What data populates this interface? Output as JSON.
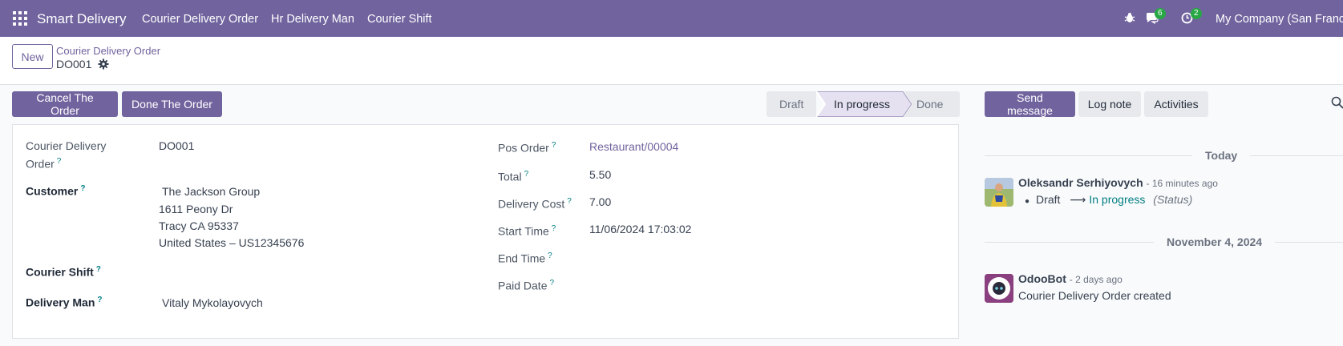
{
  "navbar": {
    "brand": "Smart Delivery",
    "menu": [
      "Courier Delivery Order",
      "Hr Delivery Man",
      "Courier Shift"
    ],
    "messages_count": "6",
    "activities_count": "2",
    "company": "My Company (San Francisco)"
  },
  "control_panel": {
    "new_label": "New",
    "breadcrumb": "Courier Delivery Order",
    "record_name": "DO001"
  },
  "actions": {
    "cancel_label": "Cancel The Order",
    "done_label": "Done The Order"
  },
  "statusbar": {
    "stages": [
      "Draft",
      "In progress",
      "Done"
    ],
    "active": "In progress"
  },
  "form": {
    "name_label_1": "Courier Delivery",
    "name_label_2": "Order",
    "name_value": "DO001",
    "customer_label": "Customer",
    "customer_name": "The Jackson Group",
    "customer_street": "1611 Peony Dr",
    "customer_city": "Tracy CA 95337",
    "customer_country": "United States – US12345676",
    "courier_shift_label": "Courier Shift",
    "courier_shift_value": "",
    "delivery_man_label": "Delivery Man",
    "delivery_man_value": "Vitaly Mykolayovych",
    "pos_order_label": "Pos Order",
    "pos_order_value": "Restaurant/00004",
    "total_label": "Total",
    "total_value": "5.50",
    "delivery_cost_label": "Delivery Cost",
    "delivery_cost_value": "7.00",
    "start_time_label": "Start Time",
    "start_time_value": "11/06/2024 17:03:02",
    "end_time_label": "End Time",
    "end_time_value": "",
    "paid_date_label": "Paid Date",
    "paid_date_value": "",
    "help_mark": "?"
  },
  "chatter": {
    "send_message": "Send message",
    "log_note": "Log note",
    "activities": "Activities",
    "today": "Today",
    "msg1": {
      "author": "Oleksandr Serhiyovych",
      "time": "- 16 minutes ago",
      "from": "Draft",
      "arrow": "⟶",
      "to": "In progress",
      "field": "(Status)"
    },
    "date2": "November 4, 2024",
    "msg2": {
      "author": "OdooBot",
      "time": "- 2 days ago",
      "body": "Courier Delivery Order created"
    }
  },
  "colors": {
    "brand": "#71639e",
    "badge": "#28a745",
    "help": "#017e84"
  }
}
